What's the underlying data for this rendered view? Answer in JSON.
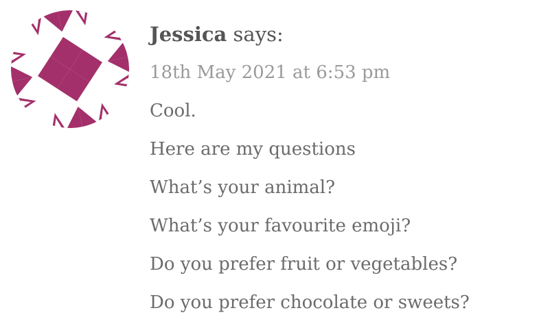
{
  "comment": {
    "author": "Jessica",
    "says": "says:",
    "date": "18th May 2021 at 6:53 pm",
    "lines": [
      "Cool.",
      "Here are my questions",
      "What’s your animal?",
      "What’s your favourite emoji?",
      "Do you prefer fruit or vegetables?",
      "Do you prefer chocolate or sweets?"
    ]
  },
  "avatar": {
    "type": "identicon",
    "color": "#A3306A",
    "icon": "identicon-avatar"
  }
}
